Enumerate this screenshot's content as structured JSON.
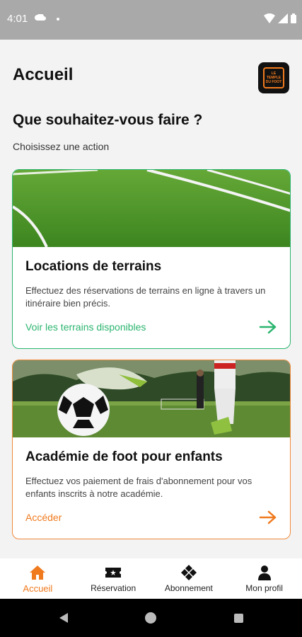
{
  "status": {
    "time": "4:01"
  },
  "header": {
    "title": "Accueil",
    "logo_text": [
      "LE",
      "TEMPLE",
      "DU FOOT"
    ]
  },
  "intro": {
    "title": "Que souhaitez-vous faire ?",
    "subtitle": "Choisissez une action"
  },
  "cards": [
    {
      "title": "Locations de terrains",
      "description": "Effectuez des réservations de terrains en ligne à travers un itinéraire bien précis.",
      "link": "Voir les terrains disponibles",
      "accent": "#2bb56f",
      "image": "football-pitch-grass"
    },
    {
      "title": "Académie de foot pour enfants",
      "description": "Effectuez vos paiement de frais d'abonnement pour vos enfants inscrits à notre académie.",
      "link": "Accéder",
      "accent": "#f07a1e",
      "image": "soccer-ball-player-foot"
    }
  ],
  "nav": [
    {
      "label": "Accueil",
      "icon": "home-icon",
      "active": true
    },
    {
      "label": "Réservation",
      "icon": "ticket-icon",
      "active": false
    },
    {
      "label": "Abonnement",
      "icon": "diamonds-icon",
      "active": false
    },
    {
      "label": "Mon profil",
      "icon": "person-icon",
      "active": false
    }
  ],
  "colors": {
    "accent_orange": "#f07a1e",
    "accent_green": "#2bb56f",
    "status_bar": "#a9a9a9"
  }
}
